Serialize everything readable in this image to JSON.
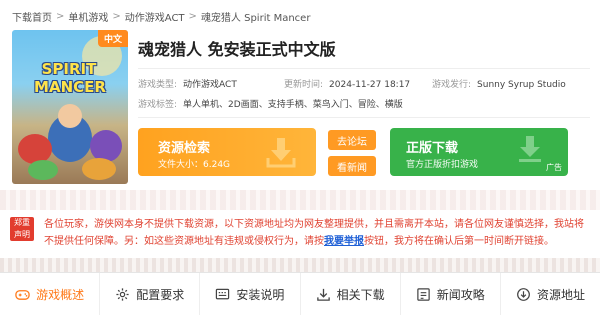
{
  "breadcrumb": [
    "下载首页",
    "单机游戏",
    "动作游戏ACT",
    "魂宠猎人 Spirit Mancer"
  ],
  "cover": {
    "badge": "中文",
    "logo_line1": "SPIRIT",
    "logo_line2": "MANCER"
  },
  "title": "魂宠猎人 免安装正式中文版",
  "meta": {
    "type_label": "游戏类型:",
    "type_value": "动作游戏ACT",
    "updated_label": "更新时间:",
    "updated_value": "2024-11-27 18:17",
    "publisher_label": "游戏发行:",
    "publisher_value": "Sunny Syrup Studio",
    "tags_label": "游戏标签:",
    "tags_value": "单人单机、2D画面、支持手柄、菜鸟入门、冒险、横版"
  },
  "download": {
    "title": "资源检索",
    "size": "文件大小：6.24G"
  },
  "forum_button": "去论坛",
  "news_button": "看新闻",
  "official": {
    "title": "正版下载",
    "subtitle": "官方正版折扣游戏",
    "ad": "广告"
  },
  "notice": {
    "tag_line1": "郑重",
    "tag_line2": "声明",
    "text_before": "各位玩家，游侠网本身不提供下载资源，以下资源地址均为网友整理提供，并且需离开本站，请各位网友谨慎选择，我站将不提供任何保障。另：如这些资源地址有违规或侵权行为，请按",
    "report_link": "我要举报",
    "text_after": "按钮，我方将在确认后第一时间断开链接。"
  },
  "tabs": [
    {
      "label": "游戏概述",
      "icon": "gamepad-icon"
    },
    {
      "label": "配置要求",
      "icon": "gear-icon"
    },
    {
      "label": "安装说明",
      "icon": "install-icon"
    },
    {
      "label": "相关下载",
      "icon": "download-icon"
    },
    {
      "label": "新闻攻略",
      "icon": "news-icon"
    },
    {
      "label": "资源地址",
      "icon": "circle-download-icon"
    }
  ],
  "colors": {
    "accent": "#ff9a23",
    "green": "#38b24a",
    "notice_red": "#e04433",
    "link_blue": "#1e5fd6"
  }
}
